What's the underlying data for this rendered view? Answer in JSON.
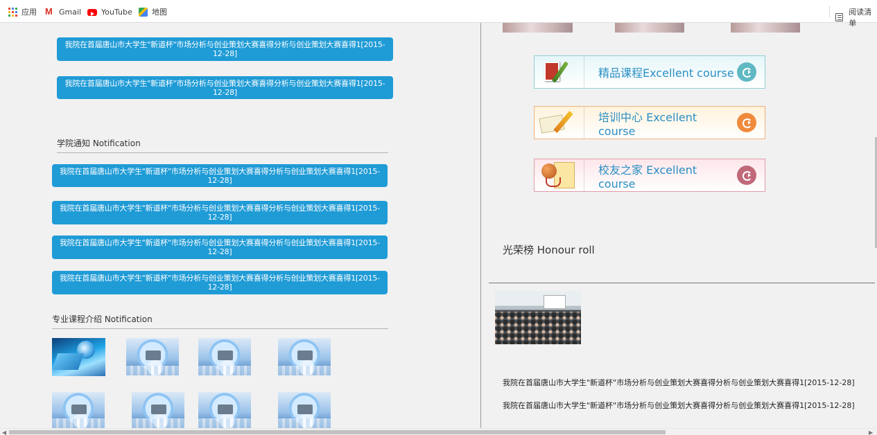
{
  "bookmarks": [
    {
      "label": "应用",
      "icon": "apps-grid-icon"
    },
    {
      "label": "Gmail",
      "icon": "gmail-icon"
    },
    {
      "label": "YouTube",
      "icon": "youtube-icon"
    },
    {
      "label": "地图",
      "icon": "maps-icon"
    }
  ],
  "reading_list": {
    "label": "阅读清单",
    "icon": "reading-list-icon"
  },
  "left": {
    "top_news": [
      "我院在首届唐山市大学生\"新道杯\"市场分析与创业策划大赛喜得分析与创业策划大赛喜得1[2015-12-28]",
      "我院在首届唐山市大学生\"新道杯\"市场分析与创业策划大赛喜得分析与创业策划大赛喜得1[2015-12-28]"
    ],
    "notification_title": "学院通知 Notification",
    "notifications": [
      "我院在首届唐山市大学生\"新道杯\"市场分析与创业策划大赛喜得分析与创业策划大赛喜得1[2015-12-28]",
      "我院在首届唐山市大学生\"新道杯\"市场分析与创业策划大赛喜得分析与创业策划大赛喜得1[2015-12-28]",
      "我院在首届唐山市大学生\"新道杯\"市场分析与创业策划大赛喜得分析与创业策划大赛喜得1[2015-12-28]",
      "我院在首届唐山市大学生\"新道杯\"市场分析与创业策划大赛喜得分析与创业策划大赛喜得1[2015-12-28]"
    ],
    "course_intro_title": "专业课程介绍 Notification"
  },
  "right": {
    "course_buttons": [
      {
        "label": "精品课程Excellent course",
        "icon": "books-icon",
        "arrow_color": "#5fb8c2",
        "border": "#8fcfd6",
        "bg_from": "#e6f6f9",
        "bg_to": "#ffffff"
      },
      {
        "label": "培训中心 Excellent course",
        "icon": "pencil-paper-icon",
        "arrow_color": "#f08a3c",
        "border": "#f1b27a",
        "bg_from": "#fff2dc",
        "bg_to": "#ffffff"
      },
      {
        "label": "校友之家 Excellent course",
        "icon": "basketball-icon",
        "arrow_color": "#c0697a",
        "border": "#e39aa8",
        "bg_from": "#fde6ea",
        "bg_to": "#ffffff"
      }
    ],
    "honour_title": "光荣榜 Honour roll",
    "honour_news": [
      "我院在首届唐山市大学生\"新道杯\"市场分析与创业策划大赛喜得分析与创业策划大赛喜得1[2015-12-28]",
      "我院在首届唐山市大学生\"新道杯\"市场分析与创业策划大赛喜得分析与创业策划大赛喜得1[2015-12-28]"
    ]
  },
  "colors": {
    "news_button_bg": "#1f9bd6",
    "course_label": "#2a8fc4",
    "page_bg": "#f1f1f1"
  }
}
